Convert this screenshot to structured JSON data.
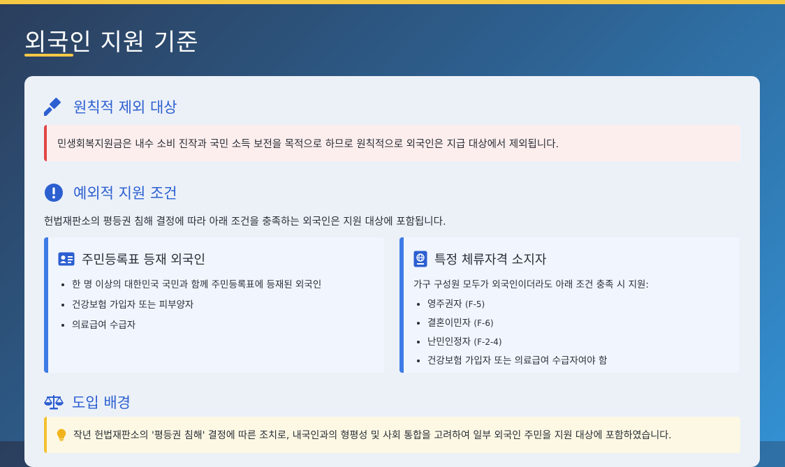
{
  "page": {
    "title": "외국인 지원 기준"
  },
  "exclusion": {
    "title": "원칙적 제외 대상",
    "icon": "gavel-icon",
    "text": "민생회복지원금은 내수 소비 진작과 국민 소득 보전을 목적으로 하므로 원칙적으로 외국인은 지급 대상에서 제외됩니다."
  },
  "exception": {
    "title": "예외적 지원 조건",
    "icon": "exclamation-circle-icon",
    "intro": "헌법재판소의 평등권 침해 결정에 따라 아래 조건을 충족하는 외국인은 지원 대상에 포함됩니다.",
    "resident": {
      "title": "주민등록표 등재 외국인",
      "icon": "id-card-icon",
      "items": [
        "한 명 이상의 대한민국 국민과 함께 주민등록표에 등재된 외국인",
        "건강보험 가입자 또는 피부양자",
        "의료급여 수급자"
      ]
    },
    "visa": {
      "title": "특정 체류자격 소지자",
      "icon": "passport-icon",
      "desc": "가구 구성원 모두가 외국인이더라도 아래 조건 충족 시 지원:",
      "items": [
        {
          "label": "영주권자",
          "code": "(F-5)"
        },
        {
          "label": "결혼이민자",
          "code": "(F-6)"
        },
        {
          "label": "난민인정자",
          "code": "(F-2-4)"
        },
        {
          "label": "건강보험 가입자 또는 의료급여 수급자여야 함",
          "code": ""
        }
      ]
    }
  },
  "background": {
    "title": "도입 배경",
    "icon": "balance-scale-icon",
    "note_icon": "lightbulb-icon",
    "text": "작년 헌법재판소의 '평등권 침해' 결정에 따른 조치로, 내국인과의 형평성 및 사회 통합을 고려하여 일부 외국인 주민을 지원 대상에 포함하였습니다."
  },
  "colors": {
    "accent": "#f6c945",
    "heading": "#2c5fd0",
    "danger": "#e04646",
    "info": "#3d7be6",
    "warning": "#f2c12e"
  }
}
